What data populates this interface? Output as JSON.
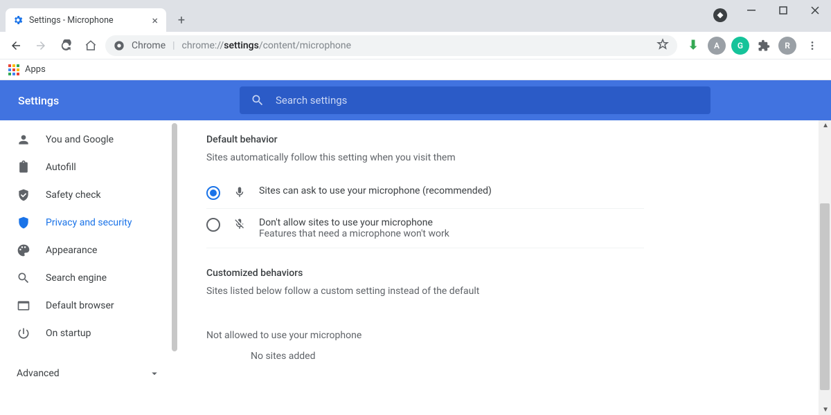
{
  "window": {
    "tab_title": "Settings - Microphone"
  },
  "omnibox": {
    "label": "Chrome",
    "url_prefix": "chrome://",
    "url_bold": "settings",
    "url_suffix": "/content/microphone"
  },
  "bookmarks": {
    "apps": "Apps"
  },
  "header": {
    "title": "Settings",
    "search_placeholder": "Search settings"
  },
  "sidebar": {
    "items": [
      {
        "label": "You and Google"
      },
      {
        "label": "Autofill"
      },
      {
        "label": "Safety check"
      },
      {
        "label": "Privacy and security"
      },
      {
        "label": "Appearance"
      },
      {
        "label": "Search engine"
      },
      {
        "label": "Default browser"
      },
      {
        "label": "On startup"
      }
    ],
    "advanced": "Advanced"
  },
  "main": {
    "section1_title": "Default behavior",
    "section1_sub": "Sites automatically follow this setting when you visit them",
    "opt1": "Sites can ask to use your microphone (recommended)",
    "opt2_l1": "Don't allow sites to use your microphone",
    "opt2_l2": "Features that need a microphone won't work",
    "section2_title": "Customized behaviors",
    "section2_sub": "Sites listed below follow a custom setting instead of the default",
    "not_allowed": "Not allowed to use your microphone",
    "no_sites": "No sites added"
  },
  "avatar_initial": "R"
}
